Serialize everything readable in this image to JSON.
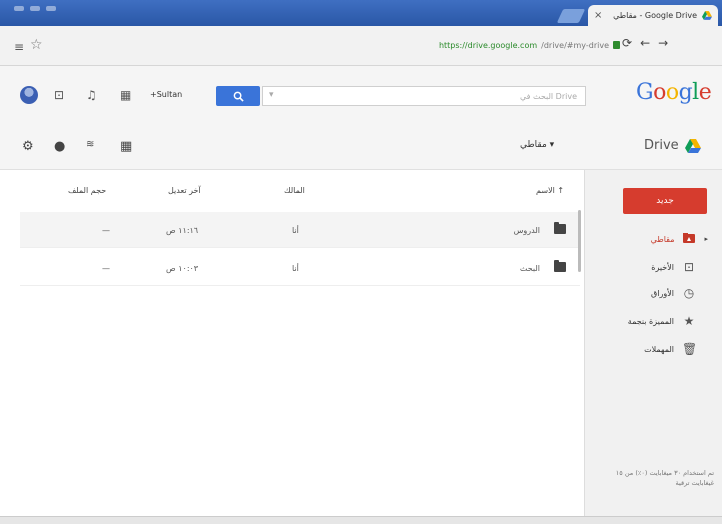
{
  "browser": {
    "tab_title": "مقاطي - Google Drive",
    "tab_close": "×",
    "url_host": "https://drive.google.com",
    "url_path": "/drive/#my-drive",
    "menu_glyph": "≡",
    "star_glyph": "☆",
    "nav_icons": [
      "⟳",
      "←",
      "→"
    ]
  },
  "header": {
    "username": "+Sultan",
    "search_button_glyph": "🔍",
    "search_placeholder": "البحث في Drive",
    "logo_letters": [
      "G",
      "o",
      "o",
      "g",
      "l",
      "e"
    ],
    "logo_colors": [
      "#3a74d9",
      "#d63c2e",
      "#f4b400",
      "#3a74d9",
      "#0f9d58",
      "#d63c2e"
    ]
  },
  "toolbar": {
    "my_drive_menu": "مقاطي ▾",
    "drive_label": "Drive"
  },
  "file_list": {
    "columns": {
      "name": "الاسم ↑",
      "owner": "المالك",
      "modified": "آخر تعديل",
      "size": "حجم الملف"
    },
    "rows": [
      {
        "name": "الدروس",
        "owner": "أنا",
        "modified": "١١:١٦ ص",
        "size": "—"
      },
      {
        "name": "البحث",
        "owner": "أنا",
        "modified": "١٠:٠٣ ص",
        "size": "—"
      }
    ]
  },
  "sidebar": {
    "new_button": "جديد",
    "items": [
      {
        "label": "مقاطي",
        "icon": "drive-folder-icon"
      },
      {
        "label": "الأخيرة",
        "icon": "recent-icon"
      },
      {
        "label": "الأوراق",
        "icon": "photos-icon"
      },
      {
        "label": "المميزة بنجمة",
        "icon": "star-icon"
      },
      {
        "label": "المهملات",
        "icon": "trash-icon"
      }
    ],
    "storage_line1": "تم استخدام ٣٠ ميغابايت (٠٪) من ١٥",
    "storage_line2": "غيغابايت ترقية"
  },
  "colors": {
    "accent_blue": "#3a74d9",
    "new_red": "#d63c2e",
    "active_red": "#c53929",
    "titlebar_blue": "#2f5fb3"
  }
}
